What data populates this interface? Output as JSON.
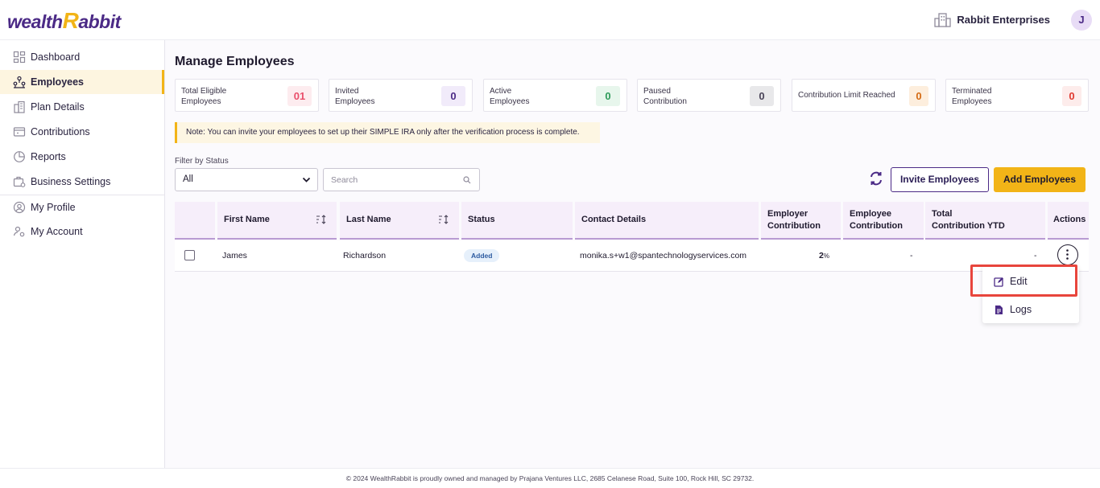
{
  "header": {
    "logo": {
      "part1": "wealth",
      "part2": "R",
      "part3": "abbit"
    },
    "company_name": "Rabbit Enterprises",
    "avatar_initial": "J"
  },
  "sidebar": {
    "items": [
      {
        "label": "Dashboard",
        "icon": "dashboard-icon"
      },
      {
        "label": "Employees",
        "icon": "employees-icon"
      },
      {
        "label": "Plan Details",
        "icon": "plan-icon"
      },
      {
        "label": "Contributions",
        "icon": "contributions-icon"
      },
      {
        "label": "Reports",
        "icon": "reports-icon"
      },
      {
        "label": "Business Settings",
        "icon": "business-settings-icon"
      },
      {
        "label": "My Profile",
        "icon": "profile-icon"
      },
      {
        "label": "My Account",
        "icon": "account-icon"
      }
    ]
  },
  "page": {
    "title": "Manage Employees"
  },
  "stats": [
    {
      "label": "Total Eligible Employees",
      "value": "01",
      "color": "#e94f6b",
      "bg": "#fdecef"
    },
    {
      "label": "Invited Employees",
      "value": "0",
      "color": "#4b2a86",
      "bg": "#f1ebfa"
    },
    {
      "label": "Active Employees",
      "value": "0",
      "color": "#2e9b5a",
      "bg": "#e7f6ec"
    },
    {
      "label": "Paused Contribution",
      "value": "0",
      "color": "#4a4458",
      "bg": "#e8e8ea"
    },
    {
      "label": "Contribution Limit Reached",
      "value": "0",
      "color": "#d46a12",
      "bg": "#fdeedd"
    },
    {
      "label": "Terminated Employees",
      "value": "0",
      "color": "#e0392f",
      "bg": "#fdeceb"
    }
  ],
  "note": "Note: You can invite your employees to set up their SIMPLE IRA only after the verification process is complete.",
  "filter": {
    "label": "Filter by Status",
    "selected": "All",
    "search_placeholder": "Search"
  },
  "actions": {
    "invite_label": "Invite Employees",
    "add_label": "Add Employees"
  },
  "table": {
    "columns": {
      "first_name": "First Name",
      "last_name": "Last Name",
      "status": "Status",
      "contact": "Contact Details",
      "employer_1": "Employer",
      "employer_2": "Contribution",
      "employee_1": "Employee",
      "employee_2": "Contribution",
      "ytd_1": "Total",
      "ytd_2": "Contribution YTD",
      "actions": "Actions"
    },
    "rows": [
      {
        "first_name": "James",
        "last_name": "Richardson",
        "status": "Added",
        "contact": "monika.s+w1@spantechnologyservices.com",
        "employer_contribution_value": "2",
        "employer_contribution_unit": "%",
        "employee_contribution": "-",
        "ytd": "-"
      }
    ]
  },
  "menu": {
    "edit_label": "Edit",
    "logs_label": "Logs"
  },
  "footer": "© 2024 WealthRabbit is proudly owned and managed by Prajana Ventures LLC, 2685 Celanese Road, Suite 100, Rock Hill, SC 29732."
}
